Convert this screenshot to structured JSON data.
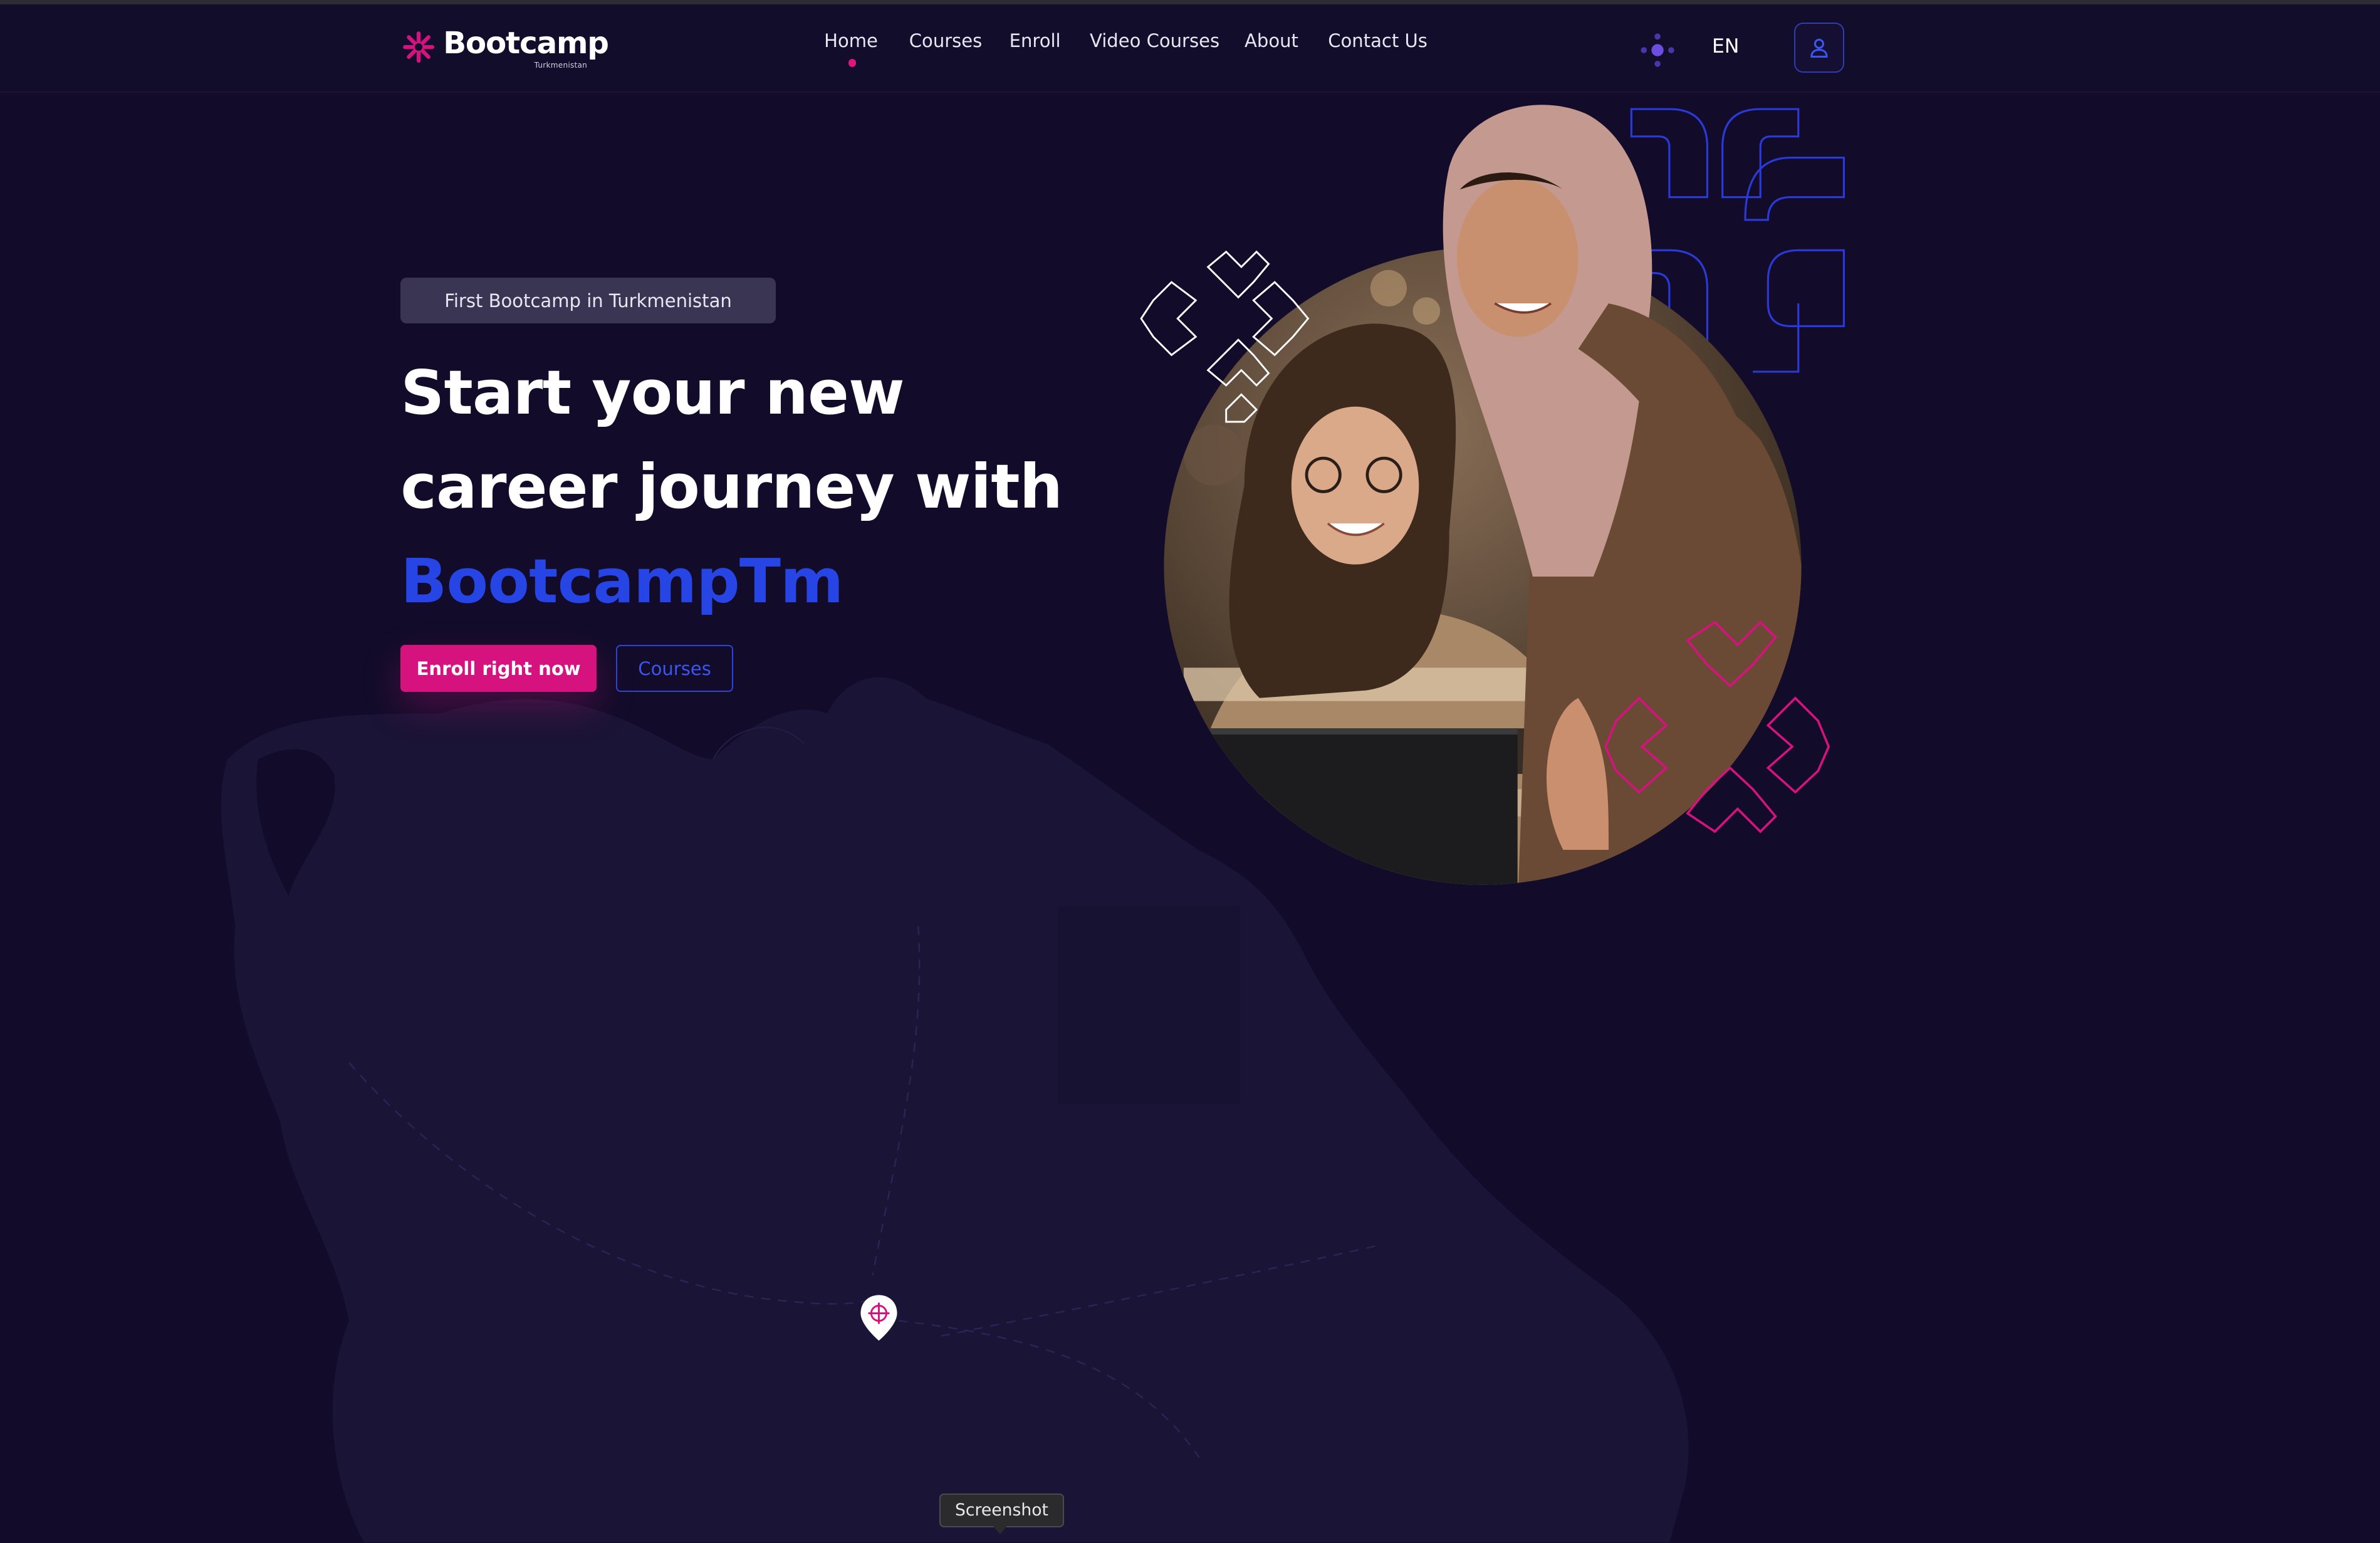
{
  "navbar": {
    "logo": {
      "name": "Bootcamp",
      "subtitle": "Turkmenistan"
    },
    "links": [
      {
        "label": "Home",
        "active": true
      },
      {
        "label": "Courses"
      },
      {
        "label": "Enroll"
      },
      {
        "label": "Video Courses"
      },
      {
        "label": "About"
      },
      {
        "label": "Contact Us"
      }
    ],
    "language": "EN",
    "theme_icon": "theme-toggle-icon",
    "user_icon": "user-icon"
  },
  "hero": {
    "badge": "First Bootcamp in Turkmenistan",
    "title_line1": "Start your new",
    "title_line2": "career journey with",
    "title_brand": "BootcampTm",
    "primary_button": "Enroll right now",
    "secondary_button": "Courses",
    "image_alt": "Two women smiling at a laptop"
  },
  "tooltip": "Screenshot",
  "colors": {
    "background": "#120c2a",
    "accent_pink": "#d6127f",
    "accent_blue": "#2645e4",
    "map": "#1a1436"
  }
}
